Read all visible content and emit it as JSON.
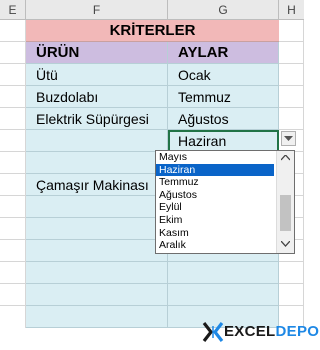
{
  "columns": [
    "E",
    "F",
    "G",
    "H"
  ],
  "table": {
    "title": "KRİTERLER",
    "headers": {
      "product": "ÜRÜN",
      "months": "AYLAR"
    },
    "rows": [
      {
        "product": "Ütü",
        "month": "Ocak"
      },
      {
        "product": "Buzdolabı",
        "month": "Temmuz"
      },
      {
        "product": "Elektrik Süpürgesi",
        "month": "Ağustos"
      },
      {
        "product": "",
        "month": "Haziran"
      },
      {
        "product": "",
        "month": ""
      },
      {
        "product": "Çamaşır Makinası",
        "month": ""
      },
      {
        "product": "",
        "month": ""
      },
      {
        "product": "",
        "month": ""
      },
      {
        "product": "",
        "month": ""
      },
      {
        "product": "",
        "month": ""
      },
      {
        "product": "",
        "month": ""
      },
      {
        "product": "",
        "month": ""
      }
    ]
  },
  "dropdown": {
    "selected": "Haziran",
    "options": [
      "Mayıs",
      "Haziran",
      "Temmuz",
      "Ağustos",
      "Eylül",
      "Ekim",
      "Kasım",
      "Aralık"
    ],
    "arrow": "chevron-down-icon"
  },
  "logo": {
    "part1": "EXCEL",
    "part2": "DEPO"
  },
  "colors": {
    "title_bg": "#f2b8b8",
    "header_bg": "#cdbde0",
    "cell_bg": "#daeef3",
    "selection": "#0a64c8",
    "active_border": "#217346",
    "logo_accent": "#1e88e5"
  }
}
